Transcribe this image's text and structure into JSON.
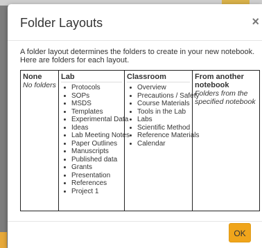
{
  "modal": {
    "title": "Folder Layouts",
    "close_label": "×",
    "intro": "A folder layout determines the folders to create in your new notebook. Here are folders for each layout.",
    "ok_label": "OK"
  },
  "layouts": {
    "none": {
      "header": "None",
      "description": "No folders"
    },
    "lab": {
      "header": "Lab",
      "items": [
        "Protocols",
        "SOPs",
        "MSDS",
        "Templates",
        "Experimental Data",
        "Ideas",
        "Lab Meeting Notes",
        "Paper Outlines",
        "Manuscripts",
        "Published data",
        "Grants",
        "Presentation",
        "References",
        "Project 1"
      ]
    },
    "classroom": {
      "header": "Classroom",
      "items": [
        "Overview",
        "Precautions / Safety",
        "Course Materials",
        "Tools in the Lab",
        "Labs",
        "Scientific Method",
        "Reference Materials",
        "Calendar"
      ]
    },
    "another": {
      "header": "From another notebook",
      "description": "Folders from the specified notebook"
    }
  },
  "colors": {
    "ok_button": "#f0a51b"
  }
}
